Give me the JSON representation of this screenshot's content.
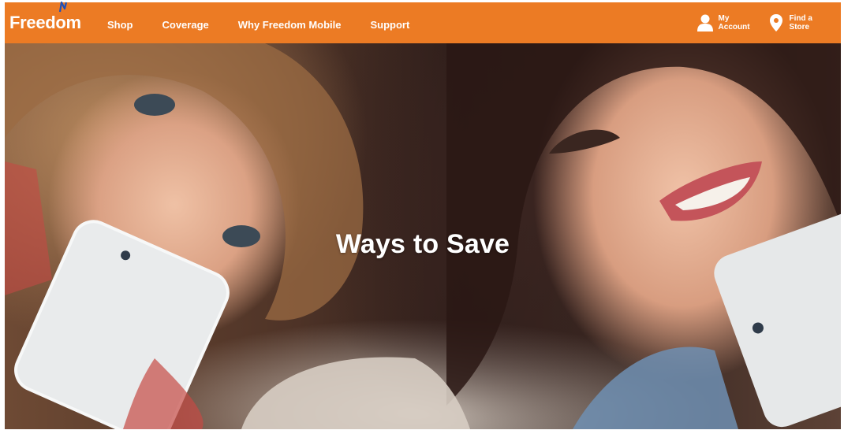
{
  "brand": {
    "logo_text": "Freedom",
    "primary_color": "#ec7b24",
    "logo_accent_color": "#1f4fb8"
  },
  "nav": {
    "links": [
      {
        "label": "Shop"
      },
      {
        "label": "Coverage"
      },
      {
        "label": "Why Freedom Mobile"
      },
      {
        "label": "Support"
      }
    ],
    "account": {
      "line1": "My",
      "line2": "Account",
      "icon": "user-icon"
    },
    "store": {
      "line1": "Find a",
      "line2": "Store",
      "icon": "map-pin-icon"
    }
  },
  "hero": {
    "title": "Ways to Save",
    "image_subject": "hero-photo"
  }
}
